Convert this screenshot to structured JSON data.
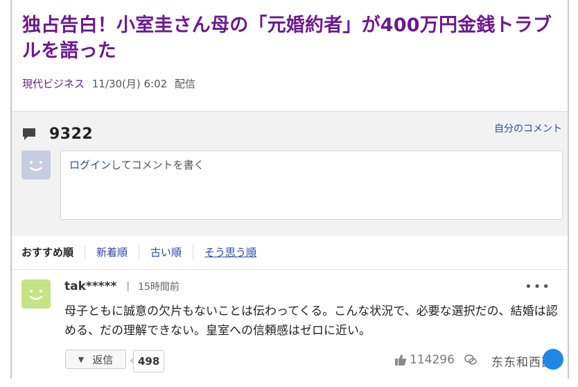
{
  "article": {
    "title": "独占告白！小室圭さん母の「元婚約者」が400万円金銭トラブルを語った",
    "source": "現代ビジネス",
    "date": "11/30(月) 6:02",
    "published_label": "配信"
  },
  "comments_panel": {
    "count": "9322",
    "my_comments_link": "自分のコメント",
    "input": {
      "login_link": "ログイン",
      "placeholder_rest": "してコメントを書く"
    }
  },
  "sort_tabs": [
    {
      "label": "おすすめ順"
    },
    {
      "label": "新着順"
    },
    {
      "label": "古い順"
    },
    {
      "label": "そう思う順"
    }
  ],
  "comment": {
    "user": "tak*****",
    "separator": "|",
    "time": "15時間前",
    "more": "•••",
    "text": "母子ともに誠意の欠片もないことは伝わってくる。こんな状況で、必要な選択だの、結婚は認める、だの理解できない。皇室への信頼感はゼロに近い。",
    "reply_label": "返信",
    "reply_caret": "▼",
    "reply_count": "498",
    "like_count": "114296"
  },
  "watermark": {
    "text": "东东和西西"
  },
  "colors": {
    "title": "#6b1a8f",
    "link": "#2948a6",
    "panel_bg": "#f2f2f2",
    "avatar_gray": "#c7cde0",
    "avatar_green": "#c6e485",
    "badge_blue": "#1e88e5"
  },
  "icons": {
    "comment_count": "speech-bubble-icon",
    "likes": "thumbs-up-icon",
    "watermark": "wechat-logo-icon",
    "more": "more-dots-icon"
  }
}
